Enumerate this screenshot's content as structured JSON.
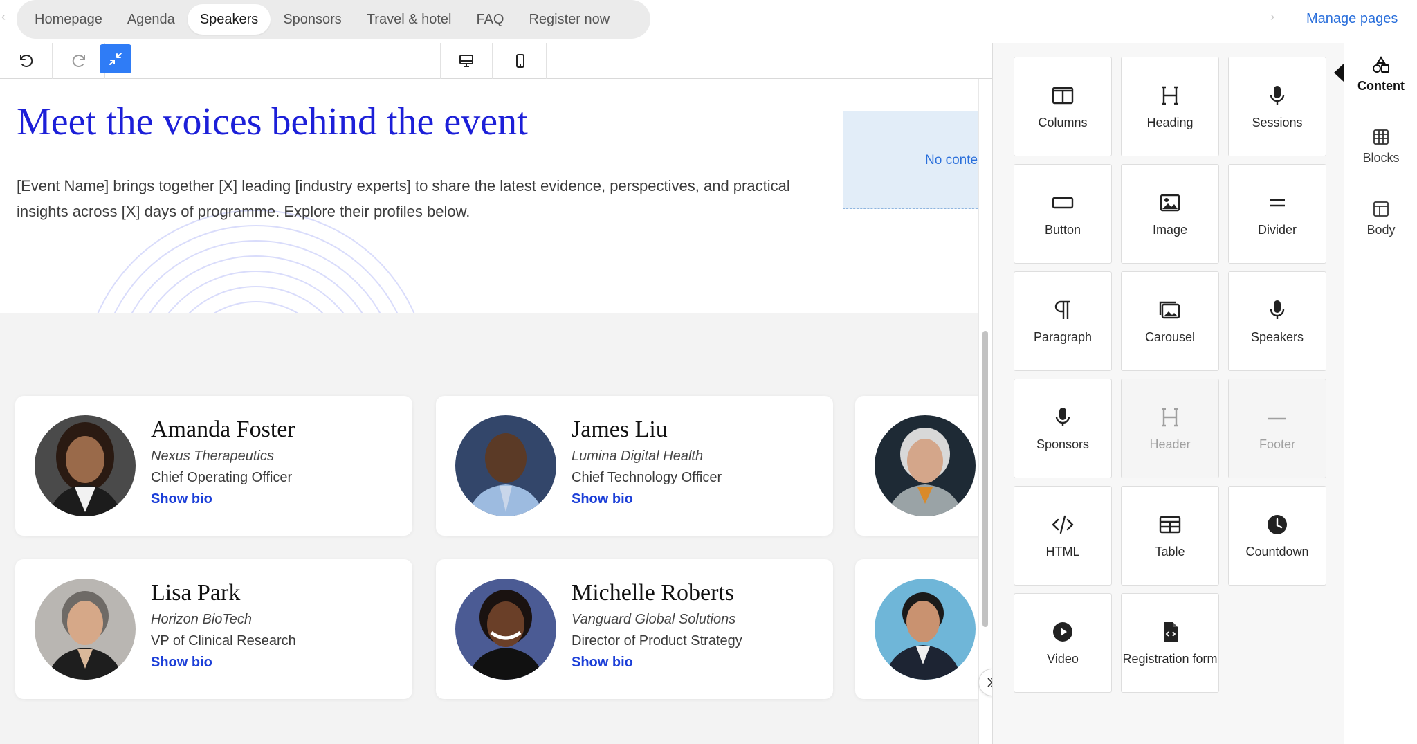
{
  "nav": {
    "tabs": [
      {
        "label": "Homepage",
        "active": false
      },
      {
        "label": "Agenda",
        "active": false
      },
      {
        "label": "Speakers",
        "active": true
      },
      {
        "label": "Sponsors",
        "active": false
      },
      {
        "label": "Travel & hotel",
        "active": false
      },
      {
        "label": "FAQ",
        "active": false
      },
      {
        "label": "Register now",
        "active": false
      }
    ],
    "manage_pages": "Manage pages"
  },
  "toolbar": {
    "undo_icon": "undo-icon",
    "redo_icon": "redo-icon",
    "collapse_icon": "collapse-icon",
    "desktop_icon": "desktop-icon",
    "mobile_icon": "mobile-icon",
    "accent_color": "#2f7cf6"
  },
  "hero": {
    "title": "Meet the voices behind the event",
    "text": "[Event Name] brings together [X] leading [industry experts] to share the latest evidence, perspectives, and practical insights across [X] days of programme. Explore their profiles below.",
    "placeholder": "No content"
  },
  "speakers": [
    {
      "name": "Amanda Foster",
      "company": "Nexus Therapeutics",
      "role": "Chief Operating Officer",
      "bio_label": "Show bio",
      "avatar": "avatar-amanda"
    },
    {
      "name": "James Liu",
      "company": "Lumina Digital Health",
      "role": "Chief Technology Officer",
      "bio_label": "Show bio",
      "avatar": "avatar-james"
    },
    {
      "name": "",
      "company": "",
      "role": "",
      "bio_label": "",
      "avatar": "avatar-woman-grey"
    },
    {
      "name": "Lisa Park",
      "company": "Horizon BioTech",
      "role": "VP of Clinical Research",
      "bio_label": "Show bio",
      "avatar": "avatar-lisa"
    },
    {
      "name": "Michelle Roberts",
      "company": "Vanguard Global Solutions",
      "role": "Director of Product Strategy",
      "bio_label": "Show bio",
      "avatar": "avatar-michelle"
    },
    {
      "name": "",
      "company": "",
      "role": "",
      "bio_label": "",
      "avatar": "avatar-man-suit"
    }
  ],
  "content_blocks": [
    {
      "label": "Columns",
      "icon": "columns-icon",
      "disabled": false
    },
    {
      "label": "Heading",
      "icon": "heading-icon",
      "disabled": false
    },
    {
      "label": "Sessions",
      "icon": "microphone-icon",
      "disabled": false
    },
    {
      "label": "Button",
      "icon": "button-icon",
      "disabled": false
    },
    {
      "label": "Image",
      "icon": "image-icon",
      "disabled": false
    },
    {
      "label": "Divider",
      "icon": "divider-icon",
      "disabled": false
    },
    {
      "label": "Paragraph",
      "icon": "paragraph-icon",
      "disabled": false
    },
    {
      "label": "Carousel",
      "icon": "carousel-icon",
      "disabled": false
    },
    {
      "label": "Speakers",
      "icon": "microphone-icon",
      "disabled": false
    },
    {
      "label": "Sponsors",
      "icon": "microphone-icon",
      "disabled": false
    },
    {
      "label": "Header",
      "icon": "heading-icon",
      "disabled": true
    },
    {
      "label": "Footer",
      "icon": "footer-icon",
      "disabled": true
    },
    {
      "label": "HTML",
      "icon": "code-icon",
      "disabled": false
    },
    {
      "label": "Table",
      "icon": "table-icon",
      "disabled": false
    },
    {
      "label": "Countdown",
      "icon": "clock-icon",
      "disabled": false
    },
    {
      "label": "Video",
      "icon": "play-icon",
      "disabled": false
    },
    {
      "label": "Registration form",
      "icon": "form-icon",
      "disabled": false
    }
  ],
  "side_nav": [
    {
      "label": "Content",
      "icon": "shapes-icon",
      "active": true
    },
    {
      "label": "Blocks",
      "icon": "blocks-icon",
      "active": false
    },
    {
      "label": "Body",
      "icon": "body-icon",
      "active": false
    }
  ]
}
